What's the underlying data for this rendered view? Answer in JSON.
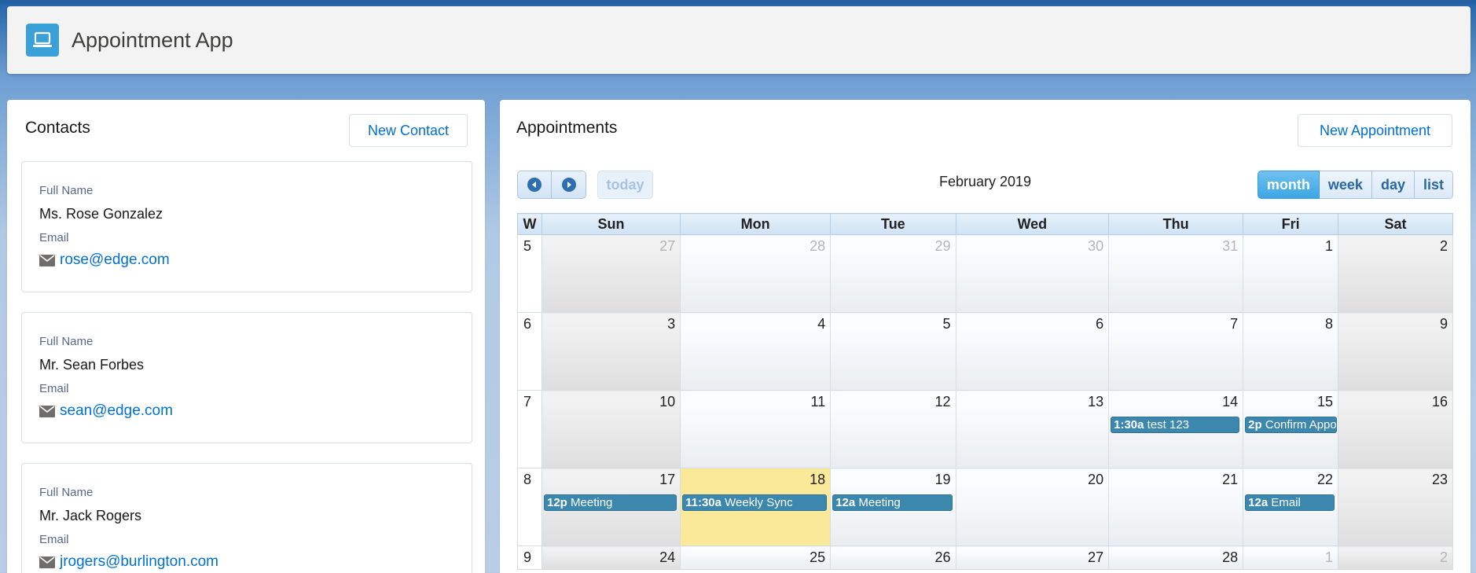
{
  "app": {
    "title": "Appointment App",
    "icon": "laptop-icon",
    "accent": "#3aa0d8"
  },
  "contacts": {
    "title": "Contacts",
    "new_button": "New Contact",
    "items": [
      {
        "name_label": "Full Name",
        "name": "Ms. Rose Gonzalez",
        "email_label": "Email",
        "email": "rose@edge.com"
      },
      {
        "name_label": "Full Name",
        "name": "Mr. Sean Forbes",
        "email_label": "Email",
        "email": "sean@edge.com"
      },
      {
        "name_label": "Full Name",
        "name": "Mr. Jack Rogers",
        "email_label": "Email",
        "email": "jrogers@burlington.com"
      }
    ]
  },
  "appointments": {
    "title": "Appointments",
    "new_button": "New Appointment",
    "calendar": {
      "title": "February 2019",
      "today_label": "today",
      "views": [
        "month",
        "week",
        "day",
        "list"
      ],
      "active_view": "month",
      "headers": [
        "W",
        "Sun",
        "Mon",
        "Tue",
        "Wed",
        "Thu",
        "Fri",
        "Sat"
      ],
      "weeks": [
        {
          "week": "5",
          "days": [
            "27",
            "28",
            "29",
            "30",
            "31",
            "1",
            "2"
          ]
        },
        {
          "week": "6",
          "days": [
            "3",
            "4",
            "5",
            "6",
            "7",
            "8",
            "9"
          ]
        },
        {
          "week": "7",
          "days": [
            "10",
            "11",
            "12",
            "13",
            "14",
            "15",
            "16"
          ]
        },
        {
          "week": "8",
          "days": [
            "17",
            "18",
            "19",
            "20",
            "21",
            "22",
            "23"
          ]
        },
        {
          "week": "9",
          "days": [
            "24",
            "25",
            "26",
            "27",
            "28",
            "1",
            "2"
          ]
        }
      ],
      "events": [
        {
          "time": "1:30a",
          "title": "test 123"
        },
        {
          "time": "2p",
          "title": "Confirm Appointmer"
        },
        {
          "time": "12p",
          "title": "Meeting"
        },
        {
          "time": "11:30a",
          "title": "Weekly Sync"
        },
        {
          "time": "12a",
          "title": "Meeting"
        },
        {
          "time": "12a",
          "title": "Email"
        }
      ]
    }
  }
}
